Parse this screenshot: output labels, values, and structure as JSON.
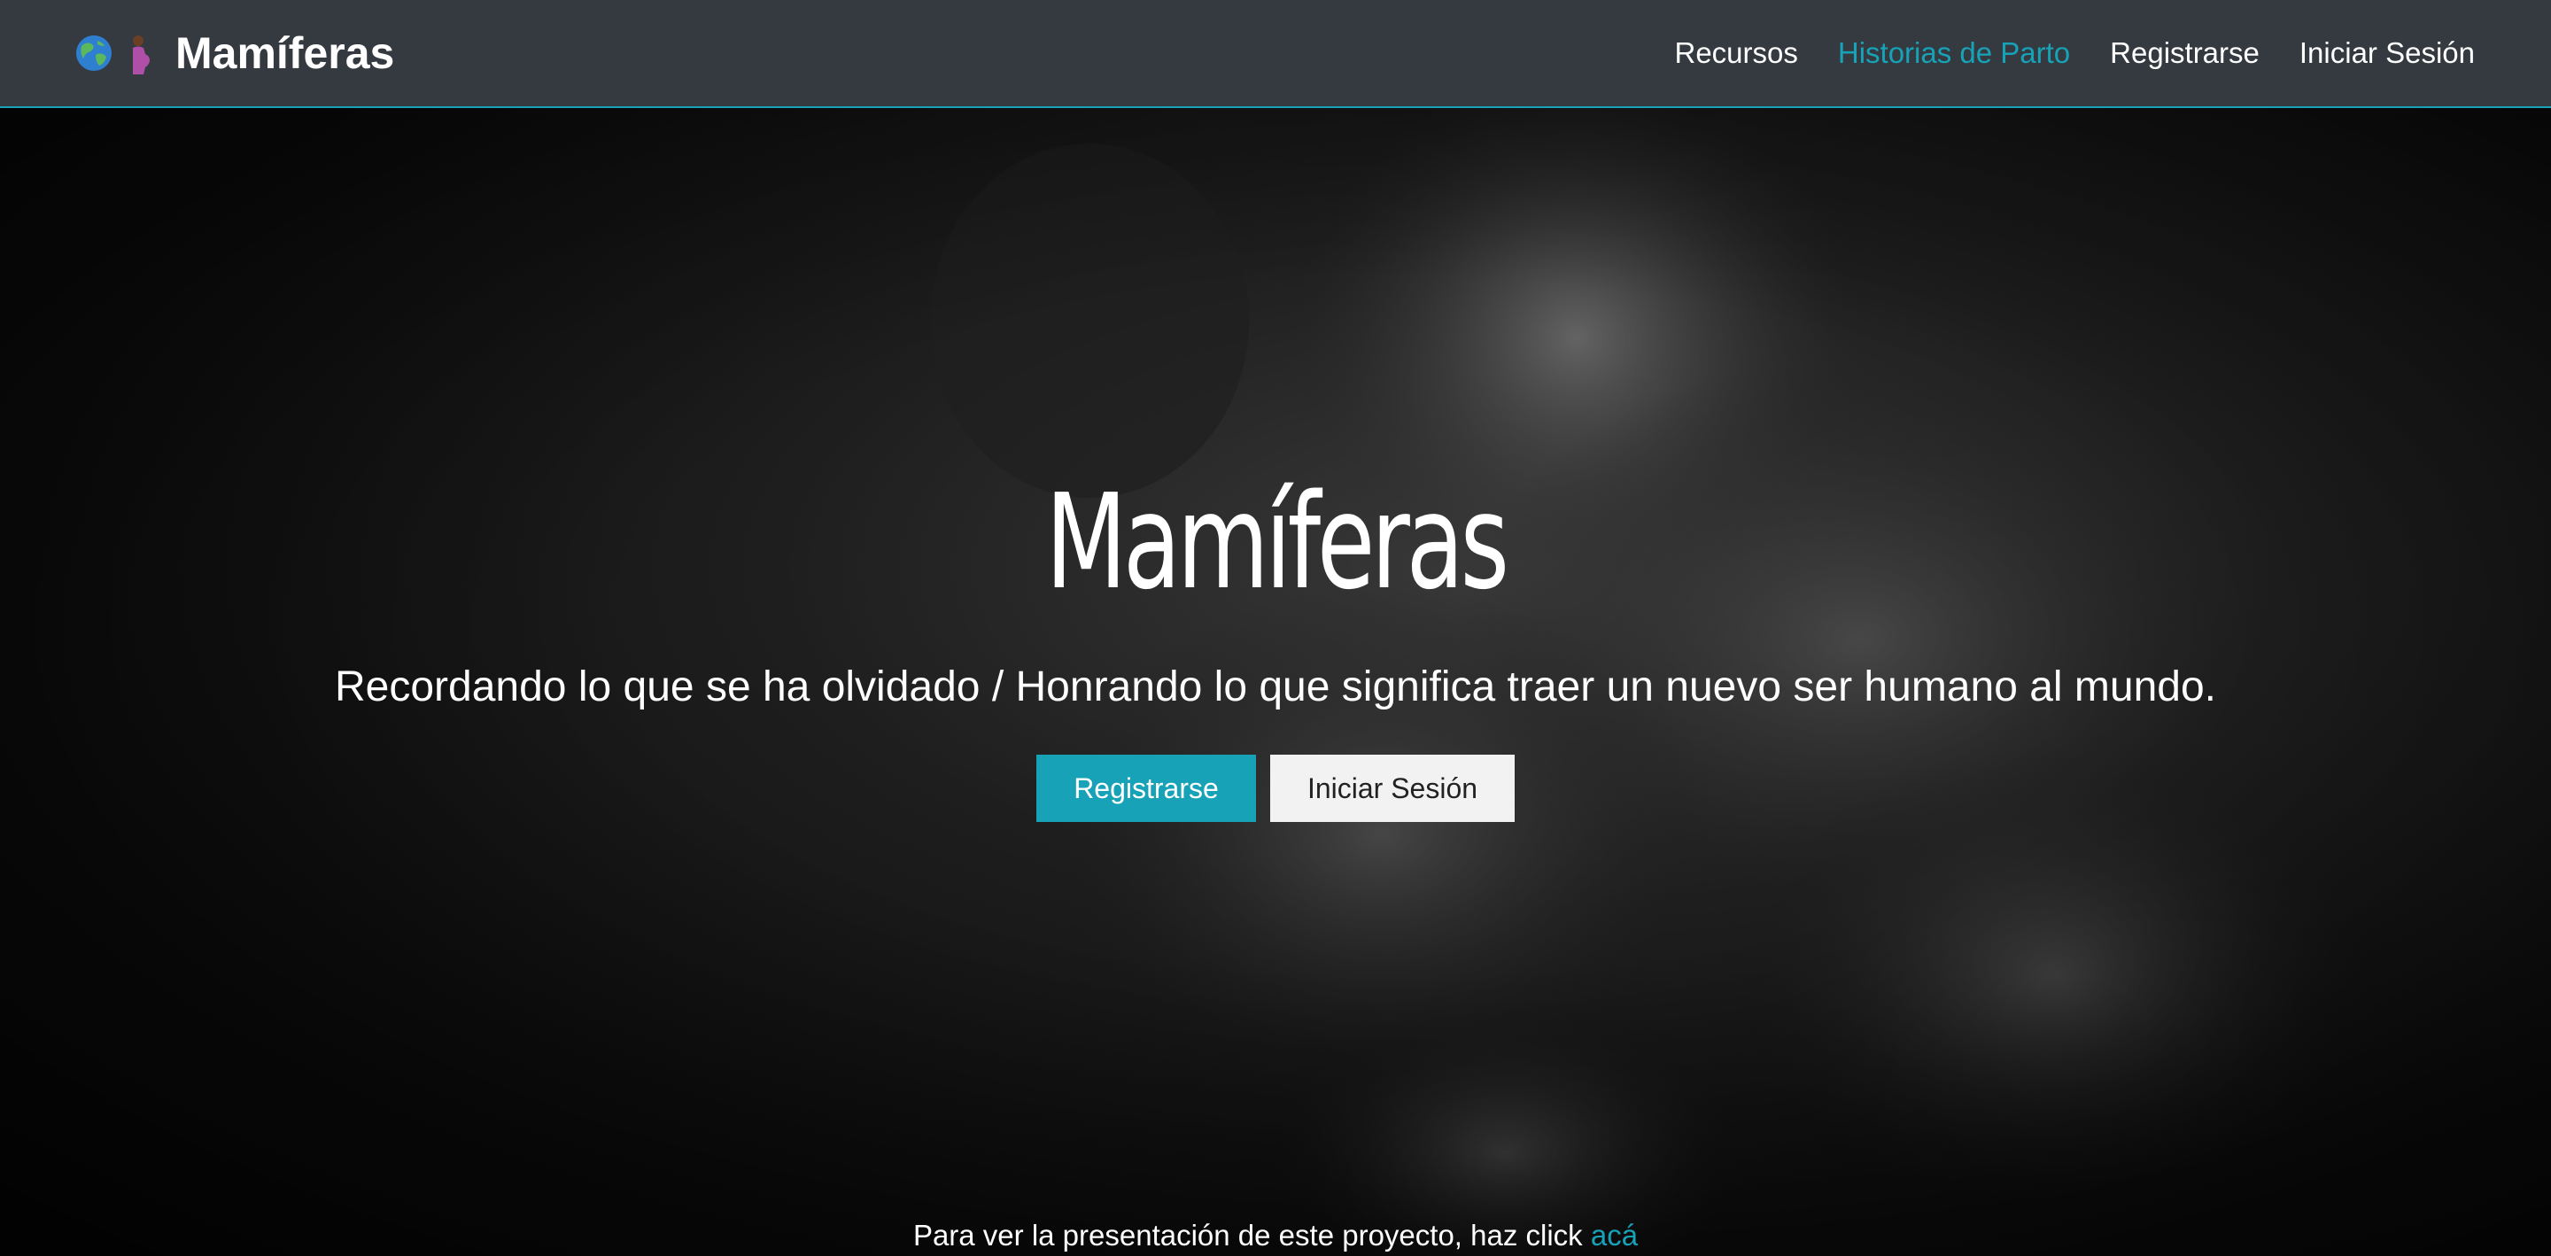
{
  "navbar": {
    "brand_name": "Mamíferas",
    "icons": [
      "globe-icon",
      "pregnant-woman-icon"
    ],
    "links": [
      {
        "label": "Recursos",
        "active": false
      },
      {
        "label": "Historias de Parto",
        "active": true
      },
      {
        "label": "Registrarse",
        "active": false
      },
      {
        "label": "Iniciar Sesión",
        "active": false
      }
    ]
  },
  "hero": {
    "title": "Mamíferas",
    "subtitle": "Recordando lo que se ha olvidado / Honrando lo que significa traer un nuevo ser humano al mundo.",
    "primary_button": "Registrarse",
    "secondary_button": "Iniciar Sesión",
    "background_image": "newborn-baby-photo"
  },
  "footer_note": {
    "text": "Para ver la presentación de este proyecto, haz click ",
    "link_label": "acá"
  },
  "colors": {
    "navbar_bg": "#343a40",
    "accent": "#17a2b8",
    "hero_bg": "#0c0c0c",
    "light_button_bg": "#f2f2f2"
  }
}
